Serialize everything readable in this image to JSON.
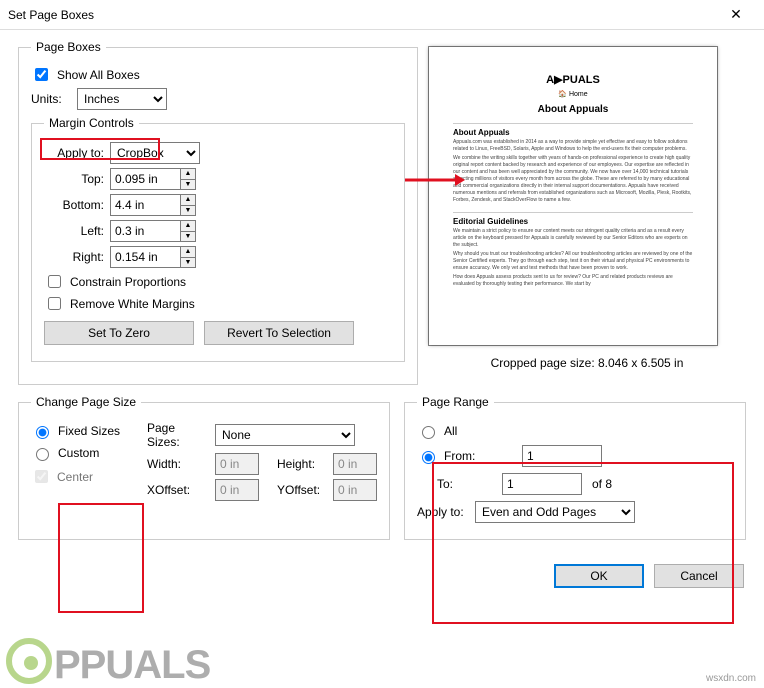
{
  "window": {
    "title": "Set Page Boxes"
  },
  "pageBoxes": {
    "legend": "Page Boxes",
    "showAll": "Show All Boxes",
    "unitsLabel": "Units:",
    "unitsValue": "Inches",
    "marginControls": {
      "legend": "Margin Controls",
      "applyToLabel": "Apply to:",
      "applyToValue": "CropBox",
      "topLabel": "Top:",
      "topValue": "0.095 in",
      "bottomLabel": "Bottom:",
      "bottomValue": "4.4 in",
      "leftLabel": "Left:",
      "leftValue": "0.3 in",
      "rightLabel": "Right:",
      "rightValue": "0.154 in",
      "constrain": "Constrain Proportions",
      "removeWhite": "Remove White Margins",
      "setZero": "Set To Zero",
      "revert": "Revert To Selection"
    }
  },
  "preview": {
    "logo": "A▶PUALS",
    "home": "🏠 Home",
    "title": "About Appuals",
    "sec1": "About Appuals",
    "body1": "Appuals.com was established in 2014 as a way to provide simple yet effective and easy to follow solutions related to Linux, FreeBSD, Solaris, Apple and Windows to help the end-users fix their computer problems.",
    "body2": "We combine the writing skills together with years of hands-on professional experience to create high quality original report content backed by research and experience of our employees. Our expertise are reflected in our content and has been well appreciated by the community. We now have over 14,000 technical tutorials attracting millions of visitors every month from across the globe. These are referred to by many educational and commercial organizations directly in their internal support documentations. Appuals have received numerous mentions and referrals from established organizations such as Microsoft, Mozilla, Plesk, Rootkits, Forbes, Zendesk, and StackOverFlow to name a few.",
    "sec2": "Editorial Guidelines",
    "body3": "We maintain a strict policy to ensure our content meets our stringent quality criteria and as a result every article on the keyboard pressed for Appuals is carefully reviewed by our Senior Editors who are experts on the subject.",
    "body4": "Why should you trust our troubleshooting articles?\nAll our troubleshooting articles are reviewed by one of the Senior Certified experts. They go through each step, test it on their virtual and physical PC environments to ensure accuracy. We only vet and test methods that have been proven to work.",
    "body5": "How does Appuals assess products sent to us for review?\nOur PC and related products reviews are evaluated by thoroughly testing their performance. We start by",
    "sizeLabel": "Cropped page size: 8.046 x 6.505 in"
  },
  "changePageSize": {
    "legend": "Change Page Size",
    "fixed": "Fixed Sizes",
    "custom": "Custom",
    "center": "Center",
    "pageSizesLabel": "Page Sizes:",
    "pageSizesValue": "None",
    "widthLabel": "Width:",
    "widthValue": "0 in",
    "heightLabel": "Height:",
    "heightValue": "0 in",
    "xoffLabel": "XOffset:",
    "xoffValue": "0 in",
    "yoffLabel": "YOffset:",
    "yoffValue": "0 in"
  },
  "pageRange": {
    "legend": "Page Range",
    "all": "All",
    "from": "From:",
    "fromValue": "1",
    "to": "To:",
    "toValue": "1",
    "ofPages": "of 8",
    "applyToLabel": "Apply to:",
    "applyToValue": "Even and Odd Pages"
  },
  "buttons": {
    "ok": "OK",
    "cancel": "Cancel"
  },
  "watermark": {
    "brand": "PPUALS",
    "site": "wsxdn.com"
  }
}
